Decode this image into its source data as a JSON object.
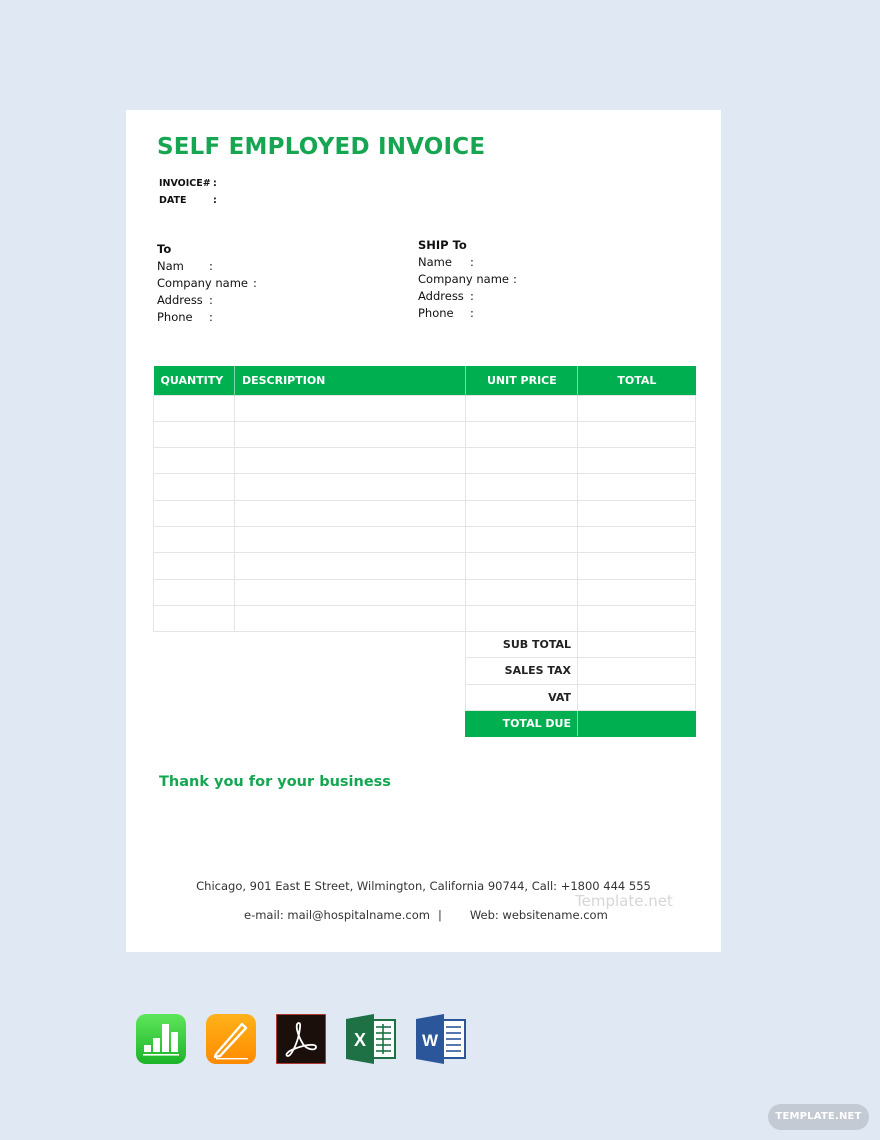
{
  "invoice": {
    "title": "SELF EMPLOYED INVOICE",
    "meta": [
      {
        "label": "INVOICE#",
        "sep": ":"
      },
      {
        "label": "DATE",
        "sep": ":"
      }
    ],
    "to": {
      "heading": "To",
      "fields": [
        {
          "label": "Nam",
          "sep": ":"
        },
        {
          "label": "Company name",
          "sep": ":"
        },
        {
          "label": "Address",
          "sep": ":"
        },
        {
          "label": "Phone",
          "sep": ":"
        }
      ]
    },
    "ship_to": {
      "heading": "SHIP To",
      "fields": [
        {
          "label": "Name",
          "sep": ":"
        },
        {
          "label": "Company name",
          "sep": ":"
        },
        {
          "label": "Address",
          "sep": ":"
        },
        {
          "label": "Phone",
          "sep": ":"
        }
      ]
    },
    "table": {
      "headers": [
        "QUANTITY",
        "DESCRIPTION",
        "UNIT PRICE",
        "TOTAL"
      ],
      "rows": [
        [
          "",
          "",
          "",
          ""
        ],
        [
          "",
          "",
          "",
          ""
        ],
        [
          "",
          "",
          "",
          ""
        ],
        [
          "",
          "",
          "",
          ""
        ],
        [
          "",
          "",
          "",
          ""
        ],
        [
          "",
          "",
          "",
          ""
        ],
        [
          "",
          "",
          "",
          ""
        ],
        [
          "",
          "",
          "",
          ""
        ],
        [
          "",
          "",
          "",
          ""
        ]
      ]
    },
    "totals": [
      {
        "label": "SUB TOTAL",
        "value": ""
      },
      {
        "label": "SALES TAX",
        "value": ""
      },
      {
        "label": "VAT",
        "value": ""
      },
      {
        "label": "TOTAL DUE",
        "value": ""
      }
    ],
    "thanks": "Thank you for your business",
    "footer": {
      "address_line": "Chicago, 901 East E Street, Wilmington, California 90744, Call: +1800 444 555",
      "email": "e-mail: mail@hospitalname.com",
      "separator": "|",
      "web": "Web: websitename.com"
    },
    "watermark": "Template.net"
  },
  "colors": {
    "accent_green": "#00b050",
    "title_green": "#16a652",
    "background": "#dfe8f3"
  },
  "apps": [
    {
      "name": "Numbers",
      "icon": "numbers-app-icon"
    },
    {
      "name": "Pages",
      "icon": "pages-app-icon"
    },
    {
      "name": "Adobe Acrobat",
      "icon": "acrobat-pdf-icon"
    },
    {
      "name": "Excel",
      "icon": "excel-icon"
    },
    {
      "name": "Word",
      "icon": "word-icon"
    }
  ],
  "brand_badge": "TEMPLATE.NET"
}
